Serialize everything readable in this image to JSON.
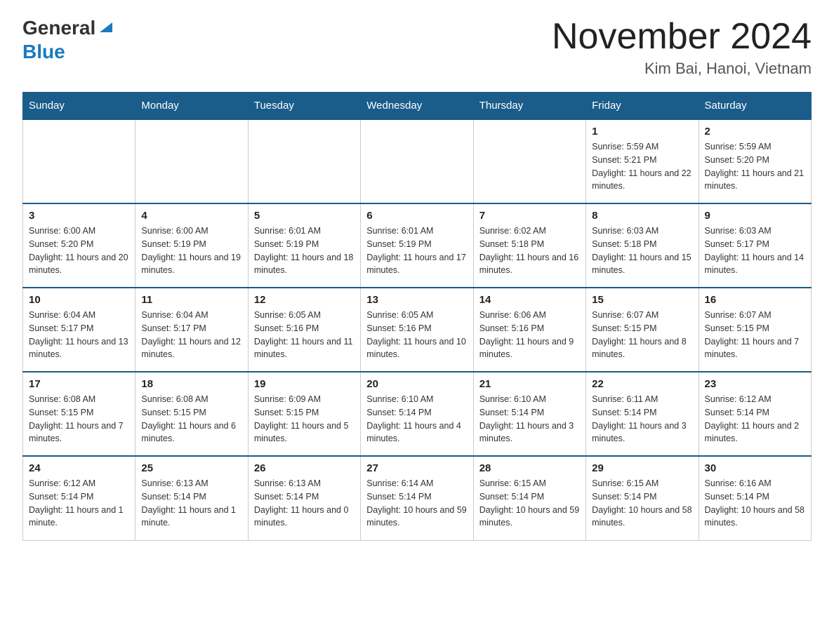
{
  "header": {
    "logo_general": "General",
    "logo_blue": "Blue",
    "month_year": "November 2024",
    "location": "Kim Bai, Hanoi, Vietnam"
  },
  "days_of_week": [
    "Sunday",
    "Monday",
    "Tuesday",
    "Wednesday",
    "Thursday",
    "Friday",
    "Saturday"
  ],
  "weeks": [
    [
      {
        "day": "",
        "info": ""
      },
      {
        "day": "",
        "info": ""
      },
      {
        "day": "",
        "info": ""
      },
      {
        "day": "",
        "info": ""
      },
      {
        "day": "",
        "info": ""
      },
      {
        "day": "1",
        "info": "Sunrise: 5:59 AM\nSunset: 5:21 PM\nDaylight: 11 hours and 22 minutes."
      },
      {
        "day": "2",
        "info": "Sunrise: 5:59 AM\nSunset: 5:20 PM\nDaylight: 11 hours and 21 minutes."
      }
    ],
    [
      {
        "day": "3",
        "info": "Sunrise: 6:00 AM\nSunset: 5:20 PM\nDaylight: 11 hours and 20 minutes."
      },
      {
        "day": "4",
        "info": "Sunrise: 6:00 AM\nSunset: 5:19 PM\nDaylight: 11 hours and 19 minutes."
      },
      {
        "day": "5",
        "info": "Sunrise: 6:01 AM\nSunset: 5:19 PM\nDaylight: 11 hours and 18 minutes."
      },
      {
        "day": "6",
        "info": "Sunrise: 6:01 AM\nSunset: 5:19 PM\nDaylight: 11 hours and 17 minutes."
      },
      {
        "day": "7",
        "info": "Sunrise: 6:02 AM\nSunset: 5:18 PM\nDaylight: 11 hours and 16 minutes."
      },
      {
        "day": "8",
        "info": "Sunrise: 6:03 AM\nSunset: 5:18 PM\nDaylight: 11 hours and 15 minutes."
      },
      {
        "day": "9",
        "info": "Sunrise: 6:03 AM\nSunset: 5:17 PM\nDaylight: 11 hours and 14 minutes."
      }
    ],
    [
      {
        "day": "10",
        "info": "Sunrise: 6:04 AM\nSunset: 5:17 PM\nDaylight: 11 hours and 13 minutes."
      },
      {
        "day": "11",
        "info": "Sunrise: 6:04 AM\nSunset: 5:17 PM\nDaylight: 11 hours and 12 minutes."
      },
      {
        "day": "12",
        "info": "Sunrise: 6:05 AM\nSunset: 5:16 PM\nDaylight: 11 hours and 11 minutes."
      },
      {
        "day": "13",
        "info": "Sunrise: 6:05 AM\nSunset: 5:16 PM\nDaylight: 11 hours and 10 minutes."
      },
      {
        "day": "14",
        "info": "Sunrise: 6:06 AM\nSunset: 5:16 PM\nDaylight: 11 hours and 9 minutes."
      },
      {
        "day": "15",
        "info": "Sunrise: 6:07 AM\nSunset: 5:15 PM\nDaylight: 11 hours and 8 minutes."
      },
      {
        "day": "16",
        "info": "Sunrise: 6:07 AM\nSunset: 5:15 PM\nDaylight: 11 hours and 7 minutes."
      }
    ],
    [
      {
        "day": "17",
        "info": "Sunrise: 6:08 AM\nSunset: 5:15 PM\nDaylight: 11 hours and 7 minutes."
      },
      {
        "day": "18",
        "info": "Sunrise: 6:08 AM\nSunset: 5:15 PM\nDaylight: 11 hours and 6 minutes."
      },
      {
        "day": "19",
        "info": "Sunrise: 6:09 AM\nSunset: 5:15 PM\nDaylight: 11 hours and 5 minutes."
      },
      {
        "day": "20",
        "info": "Sunrise: 6:10 AM\nSunset: 5:14 PM\nDaylight: 11 hours and 4 minutes."
      },
      {
        "day": "21",
        "info": "Sunrise: 6:10 AM\nSunset: 5:14 PM\nDaylight: 11 hours and 3 minutes."
      },
      {
        "day": "22",
        "info": "Sunrise: 6:11 AM\nSunset: 5:14 PM\nDaylight: 11 hours and 3 minutes."
      },
      {
        "day": "23",
        "info": "Sunrise: 6:12 AM\nSunset: 5:14 PM\nDaylight: 11 hours and 2 minutes."
      }
    ],
    [
      {
        "day": "24",
        "info": "Sunrise: 6:12 AM\nSunset: 5:14 PM\nDaylight: 11 hours and 1 minute."
      },
      {
        "day": "25",
        "info": "Sunrise: 6:13 AM\nSunset: 5:14 PM\nDaylight: 11 hours and 1 minute."
      },
      {
        "day": "26",
        "info": "Sunrise: 6:13 AM\nSunset: 5:14 PM\nDaylight: 11 hours and 0 minutes."
      },
      {
        "day": "27",
        "info": "Sunrise: 6:14 AM\nSunset: 5:14 PM\nDaylight: 10 hours and 59 minutes."
      },
      {
        "day": "28",
        "info": "Sunrise: 6:15 AM\nSunset: 5:14 PM\nDaylight: 10 hours and 59 minutes."
      },
      {
        "day": "29",
        "info": "Sunrise: 6:15 AM\nSunset: 5:14 PM\nDaylight: 10 hours and 58 minutes."
      },
      {
        "day": "30",
        "info": "Sunrise: 6:16 AM\nSunset: 5:14 PM\nDaylight: 10 hours and 58 minutes."
      }
    ]
  ]
}
